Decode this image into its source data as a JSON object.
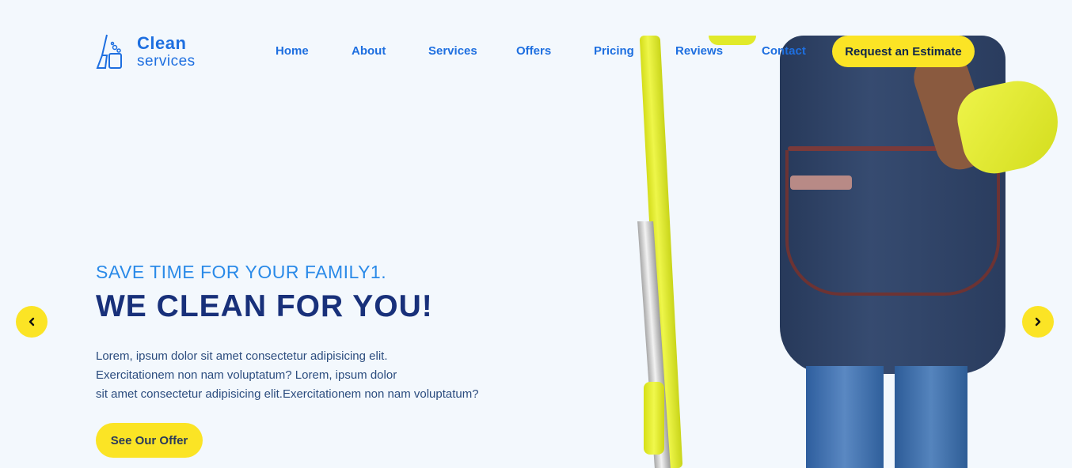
{
  "brand": {
    "name_line1": "Clean",
    "name_line2": "services",
    "logo_icon": "broom-bucket-icon",
    "color": "#1e6fe0"
  },
  "nav": {
    "items": [
      {
        "label": "Home"
      },
      {
        "label": "About"
      },
      {
        "label": "Services"
      },
      {
        "label": "Offers"
      },
      {
        "label": "Pricing"
      },
      {
        "label": "Reviews"
      },
      {
        "label": "Contact"
      }
    ],
    "cta_label": "Request an Estimate"
  },
  "hero": {
    "eyebrow": "SAVE TIME FOR YOUR FAMILY1.",
    "headline": "WE CLEAN FOR YOU!",
    "body_lines": [
      "Lorem, ipsum dolor sit amet consectetur adipisicing elit.",
      "Exercitationem non nam voluptatum? Lorem, ipsum dolor",
      "sit amet consectetur adipisicing elit.Exercitationem non nam voluptatum?"
    ],
    "button_label": "See Our Offer",
    "image": "cleaner-with-mop-photo"
  },
  "carousel": {
    "prev_icon": "chevron-left-icon",
    "next_icon": "chevron-right-icon"
  },
  "colors": {
    "background": "#f3f8fd",
    "accent_yellow": "#fbe425",
    "link_blue": "#1e6fe0",
    "headline_navy": "#18307a"
  }
}
